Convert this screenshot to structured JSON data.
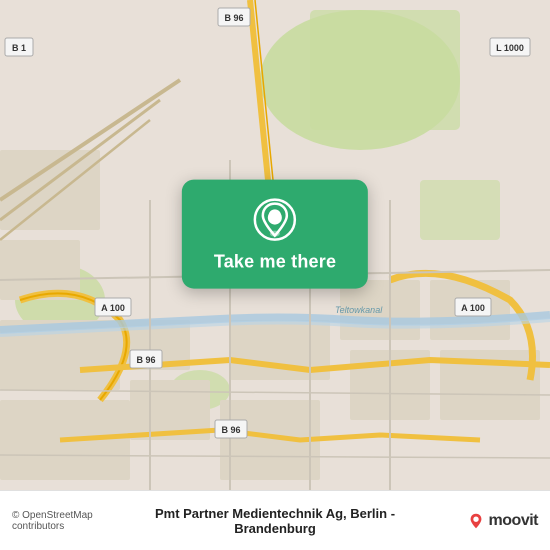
{
  "map": {
    "background_color": "#e8e0d8",
    "center_lat": 52.46,
    "center_lng": 13.39
  },
  "button": {
    "label": "Take me there",
    "background_color": "#2eaa6e",
    "pin_color": "#ffffff"
  },
  "bottom_bar": {
    "osm_credit": "© OpenStreetMap contributors",
    "place_name": "Pmt Partner Medientechnik Ag, Berlin - Brandenburg",
    "moovit_label": "moovit"
  },
  "road_labels": {
    "b96_top": "B 96",
    "b96_mid": "B 96",
    "b96_bot": "B 96",
    "a100_left": "A 100",
    "a100_right": "A 100",
    "l1000": "L 1000",
    "b1": "B 1",
    "teltowkanal": "Teltowkanal"
  },
  "icons": {
    "map_pin": "location-pin-icon",
    "moovit_pin": "moovit-brand-pin-icon"
  }
}
